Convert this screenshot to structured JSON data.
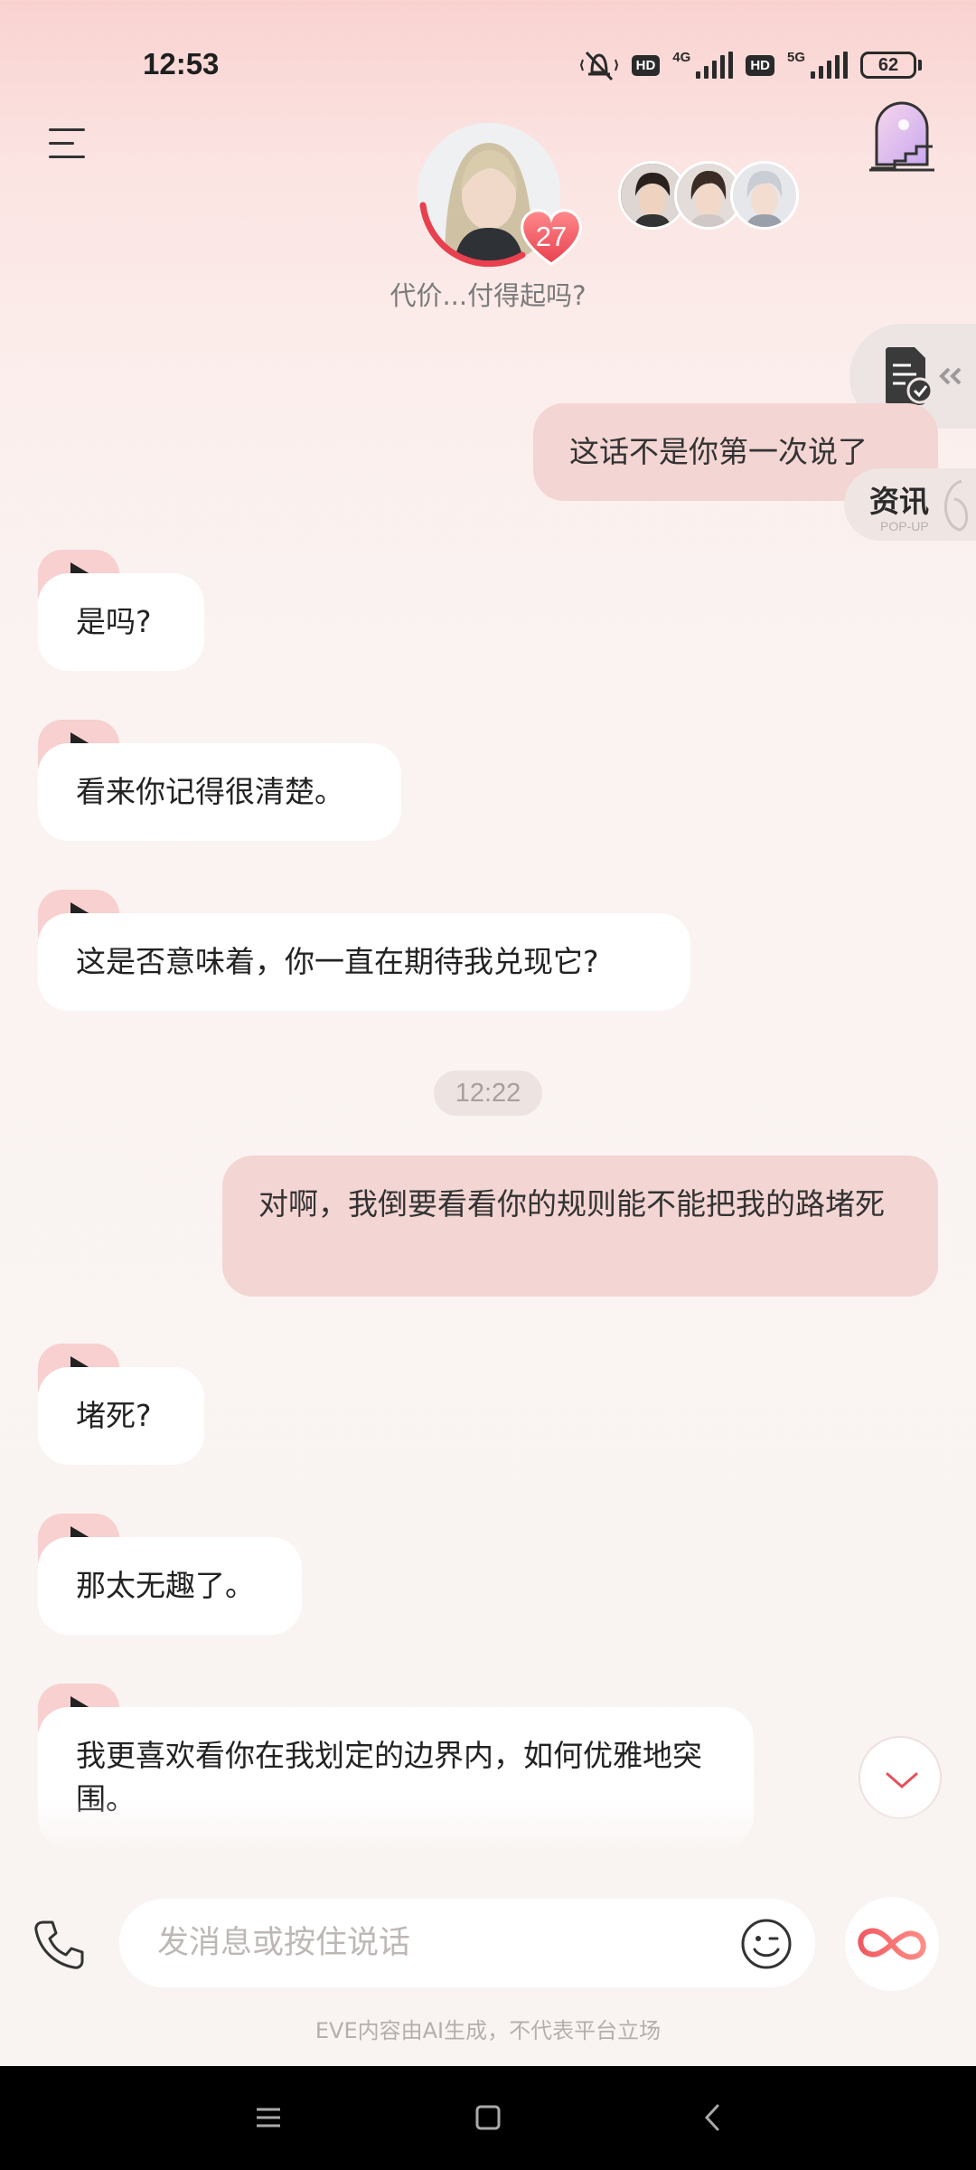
{
  "status_bar": {
    "time": "12:53",
    "network_1": "4G",
    "network_2": "5G",
    "hd_label": "HD",
    "battery": "62"
  },
  "header": {
    "affection_level": "27",
    "subtitle": "代价...付得起吗?"
  },
  "side_buttons": {
    "popup_title": "资讯",
    "popup_subtitle": "POP-UP"
  },
  "messages": [
    {
      "role": "user",
      "text": "这话不是你第一次说了"
    },
    {
      "role": "ai",
      "text": "是吗?"
    },
    {
      "role": "ai",
      "text": "看来你记得很清楚。"
    },
    {
      "role": "ai",
      "text": "这是否意味着，你一直在期待我兑现它?"
    },
    {
      "role": "time",
      "text": "12:22"
    },
    {
      "role": "user",
      "text": "对啊，我倒要看看你的规则能不能把我的路堵死"
    },
    {
      "role": "ai",
      "text": "堵死?"
    },
    {
      "role": "ai",
      "text": "那太无趣了。"
    },
    {
      "role": "ai",
      "text": "我更喜欢看你在我划定的边界内，如何优雅地突围。"
    }
  ],
  "input": {
    "placeholder": "发消息或按住说话"
  },
  "disclaimer": "EVE内容由AI生成，不代表平台立场",
  "colors": {
    "accent": "#f0606a",
    "user_bubble": "#f3d5d3",
    "ai_bubble": "#ffffff",
    "play_tab": "#f7d0cf"
  },
  "icons": {
    "menu": "menu-icon",
    "stairs": "stairs-portal-icon",
    "heart": "heart-icon",
    "document": "document-check-icon",
    "play": "play-icon",
    "chevron": "chevron-down-icon",
    "phone": "phone-icon",
    "emoji": "emoji-icon",
    "infinity": "infinity-icon"
  }
}
